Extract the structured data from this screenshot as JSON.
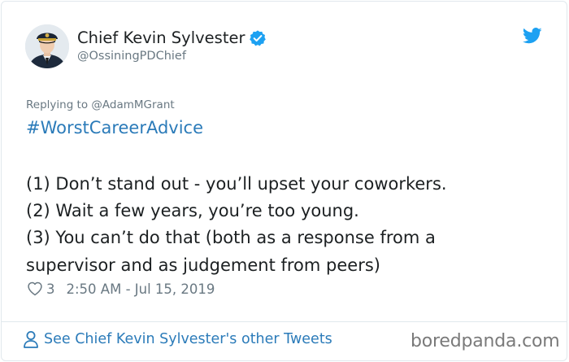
{
  "author": {
    "display_name": "Chief Kevin Sylvester",
    "handle": "@OssiningPDChief",
    "verified_icon": "verified-badge-icon",
    "avatar_icon": "police-chief-avatar"
  },
  "tweet": {
    "reply_to": "Replying to @AdamMGrant",
    "hashtag": "#WorstCareerAdvice",
    "lines": [
      "(1) Don’t stand out - you’ll upset your coworkers.",
      "(2) Wait a few years, you’re too young.",
      "(3) You can’t do that (both as a response from a",
      "supervisor and as judgement from peers)"
    ],
    "likes": "3",
    "timestamp": "2:50 AM - Jul 15, 2019"
  },
  "footer": {
    "see_more": "See Chief Kevin Sylvester's other Tweets",
    "person_icon": "person-icon"
  },
  "watermark": "boredpanda.com",
  "colors": {
    "link_blue": "#2b7bb9",
    "twitter_blue": "#1da1f2",
    "muted_gray": "#697882",
    "text_dark": "#1c2022",
    "border": "#e1e8ed"
  }
}
